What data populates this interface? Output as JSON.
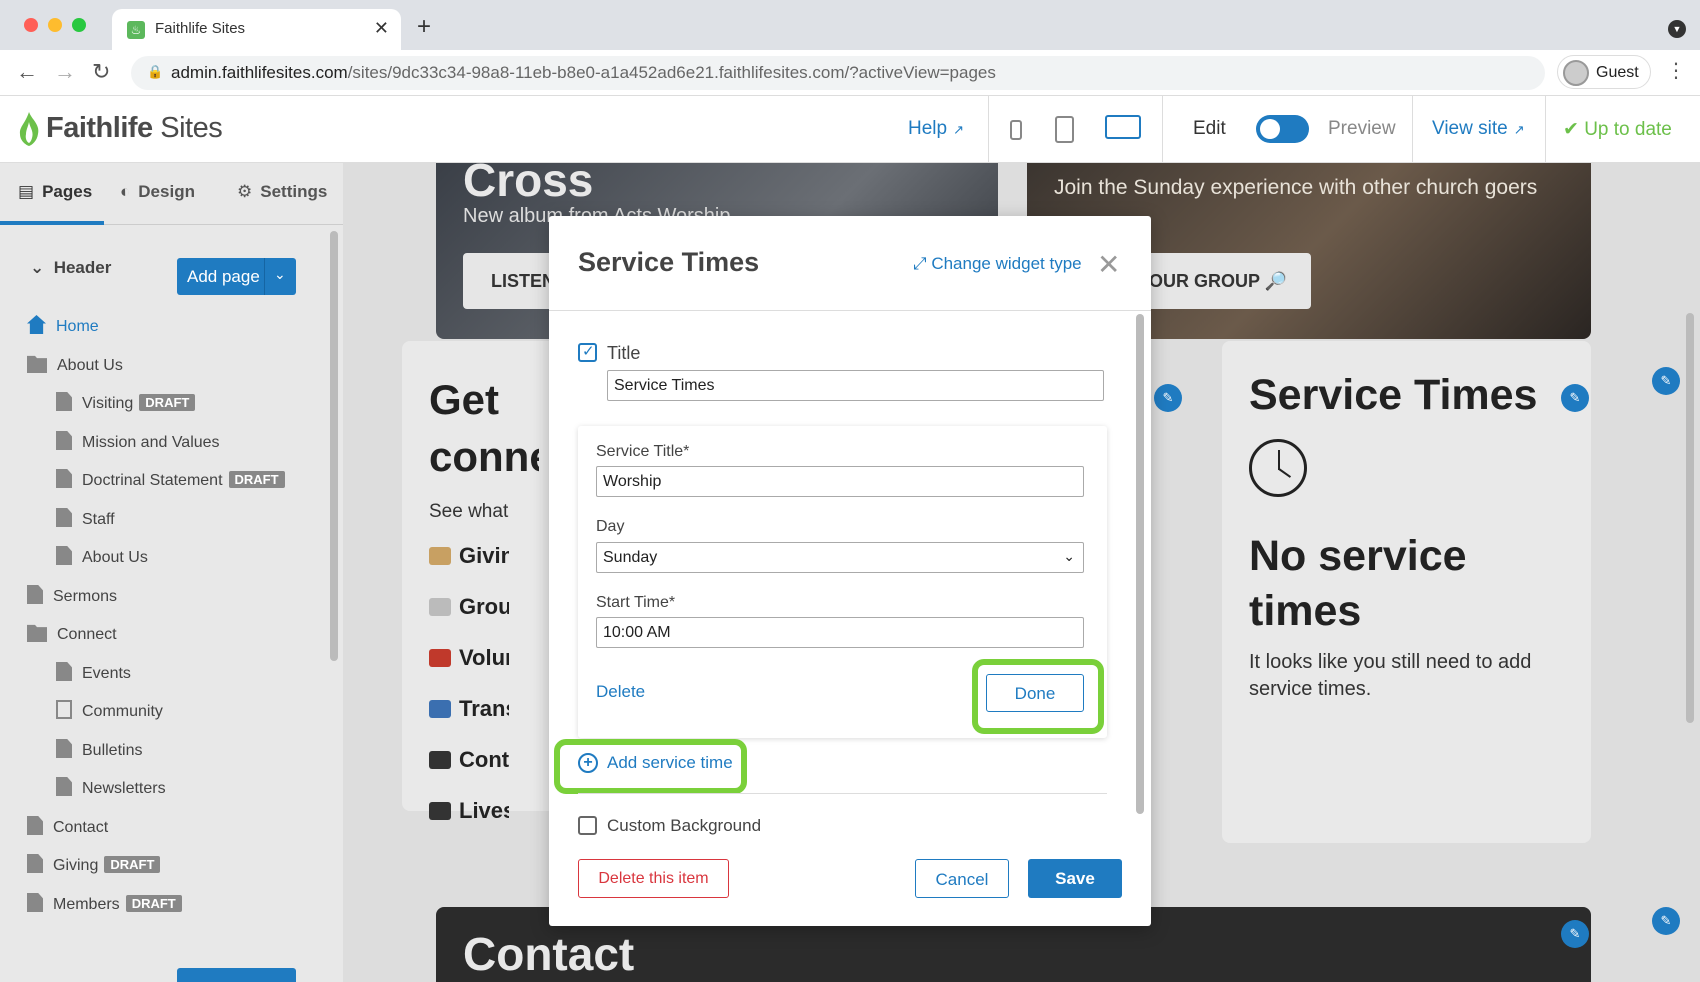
{
  "browser": {
    "tab_title": "Faithlife Sites",
    "url_host": "admin.faithlifesites.com",
    "url_path": "/sites/9dc33c34-98a8-11eb-b8e0-a1a452ad6e21.faithlifesites.com/?activeView=pages",
    "profile_label": "Guest"
  },
  "app_header": {
    "logo_bold": "Faithlife",
    "logo_light": " Sites",
    "help": "Help",
    "edit": "Edit",
    "preview": "Preview",
    "view_site": "View site",
    "status": "Up to date",
    "mode_is_edit": true
  },
  "sidebar": {
    "tabs": [
      "Pages",
      "Design",
      "Settings"
    ],
    "section": "Header",
    "add_page": "Add page",
    "draft_badge": "DRAFT",
    "items": [
      {
        "label": "Home",
        "icon": "home-icon",
        "level": 0,
        "draft": false
      },
      {
        "label": "About Us",
        "icon": "folder-icon",
        "level": 0,
        "draft": false
      },
      {
        "label": "Visiting",
        "icon": "page-icon",
        "level": 1,
        "draft": true
      },
      {
        "label": "Mission and Values",
        "icon": "page-icon",
        "level": 1,
        "draft": false
      },
      {
        "label": "Doctrinal Statement",
        "icon": "page-icon",
        "level": 1,
        "draft": true
      },
      {
        "label": "Staff",
        "icon": "page-icon",
        "level": 1,
        "draft": false
      },
      {
        "label": "About Us",
        "icon": "page-icon",
        "level": 1,
        "draft": false
      },
      {
        "label": "Sermons",
        "icon": "page-icon",
        "level": 0,
        "draft": false
      },
      {
        "label": "Connect",
        "icon": "folder-icon",
        "level": 0,
        "draft": false
      },
      {
        "label": "Events",
        "icon": "page-icon",
        "level": 1,
        "draft": false
      },
      {
        "label": "Community",
        "icon": "external-link-icon",
        "level": 1,
        "draft": false
      },
      {
        "label": "Bulletins",
        "icon": "page-icon",
        "level": 1,
        "draft": false
      },
      {
        "label": "Newsletters",
        "icon": "page-icon",
        "level": 1,
        "draft": false
      },
      {
        "label": "Contact",
        "icon": "page-icon",
        "level": 0,
        "draft": false
      },
      {
        "label": "Giving",
        "icon": "page-icon",
        "level": 0,
        "draft": true
      },
      {
        "label": "Members",
        "icon": "page-icon",
        "level": 0,
        "draft": true
      }
    ]
  },
  "canvas": {
    "hero1_title": "Cross",
    "hero1_sub": "New album from Acts Worship",
    "hero1_button": "LISTEN",
    "hero2_sub": "Join the Sunday experience with other church goers",
    "hero2_button": "OUR GROUP 🔎",
    "card1_title": "Get connected",
    "card1_sub": "See what",
    "card1_rows": [
      "Giving",
      "Groups",
      "Volunteer",
      "Transport",
      "Contact",
      "Livestream"
    ],
    "card2_title": "Service Times",
    "card2_empty_title": "No service times",
    "card2_empty_text": "It looks like you still need to add service times.",
    "contact_title": "Contact"
  },
  "modal": {
    "title": "Service Times",
    "change_widget_type": "Change widget type",
    "title_checkbox_label": "Title",
    "title_checked": true,
    "title_value": "Service Times",
    "service_title_label": "Service Title*",
    "service_title_value": "Worship",
    "day_label": "Day",
    "day_value": "Sunday",
    "start_time_label": "Start Time*",
    "start_time_value": "10:00 AM",
    "delete_link": "Delete",
    "done": "Done",
    "add_service_time": "Add service time",
    "custom_background_label": "Custom Background",
    "custom_background_checked": false,
    "delete_item": "Delete this item",
    "cancel": "Cancel",
    "save": "Save"
  },
  "colors": {
    "accent": "#1f7bc1",
    "highlight": "#7ad03a",
    "danger": "#d9363e",
    "success": "#6cc04a"
  }
}
